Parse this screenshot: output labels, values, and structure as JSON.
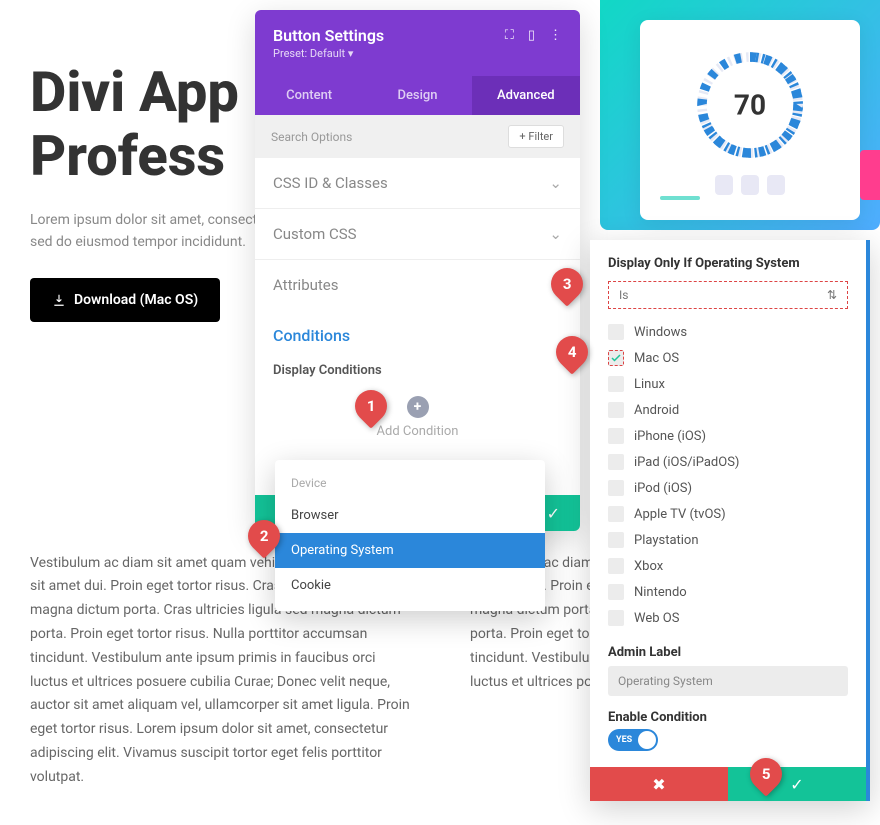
{
  "hero": {
    "title_l1": "Divi App",
    "title_l2": "Profess",
    "sub": "Lorem ipsum dolor sit amet, consectetur adipiscing elit sed do eiusmod tempor incididunt.",
    "download_label": "Download (Mac OS)"
  },
  "gauge": {
    "value": "70"
  },
  "body": {
    "left": "Vestibulum ac diam sit amet quam vehicula elementum sed sit amet dui. Proin eget tortor risus. Cras ultricies ligula sed magna dictum porta. Cras ultricies ligula sed magna dictum porta. Proin eget tortor risus. Nulla porttitor accumsan tincidunt. Vestibulum ante ipsum primis in faucibus orci luctus et ultrices posuere cubilia Curae; Donec velit neque, auctor sit amet aliquam vel, ullamcorper sit amet ligula. Proin eget tortor risus. Lorem ipsum dolor sit amet, consectetur adipiscing elit. Vivamus suscipit tortor eget felis porttitor volutpat.",
    "right": "Vestibulum ac diam sit amet quam vehicula elementum sed sit amet dui. Proin eget tortor risus. Cras ultricies ligula sed magna dictum porta. Cras ultricies ligula sed magna dictum porta. Proin eget tortor risus. Nulla porttitor accumsan tincidunt. Vestibulum ante ipsum primis in faucibus orci luctus et ultrices posuere cubilia Curae; dolor sit a"
  },
  "panel": {
    "title": "Button Settings",
    "preset": "Preset: Default ▾",
    "tabs": {
      "content": "Content",
      "design": "Design",
      "advanced": "Advanced"
    },
    "search_placeholder": "Search Options",
    "filter": "Filter",
    "sections": {
      "css_id": "CSS ID & Classes",
      "custom_css": "Custom CSS",
      "attributes": "Attributes"
    },
    "conditions_title": "Conditions",
    "display_conditions": "Display Conditions",
    "add_condition": "Add Condition"
  },
  "device_menu": {
    "header": "Device",
    "browser": "Browser",
    "os": "Operating System",
    "cookie": "Cookie"
  },
  "cond": {
    "title": "Display Only If Operating System",
    "operator": "Is",
    "options": {
      "windows": "Windows",
      "macos": "Mac OS",
      "linux": "Linux",
      "android": "Android",
      "iphone": "iPhone (iOS)",
      "ipad": "iPad (iOS/iPadOS)",
      "ipod": "iPod (iOS)",
      "appletv": "Apple TV (tvOS)",
      "ps": "Playstation",
      "xbox": "Xbox",
      "nintendo": "Nintendo",
      "webos": "Web OS"
    },
    "admin_label": "Admin Label",
    "admin_value": "Operating System",
    "enable": "Enable Condition",
    "yes": "YES"
  },
  "callouts": {
    "1": "1",
    "2": "2",
    "3": "3",
    "4": "4",
    "5": "5"
  }
}
